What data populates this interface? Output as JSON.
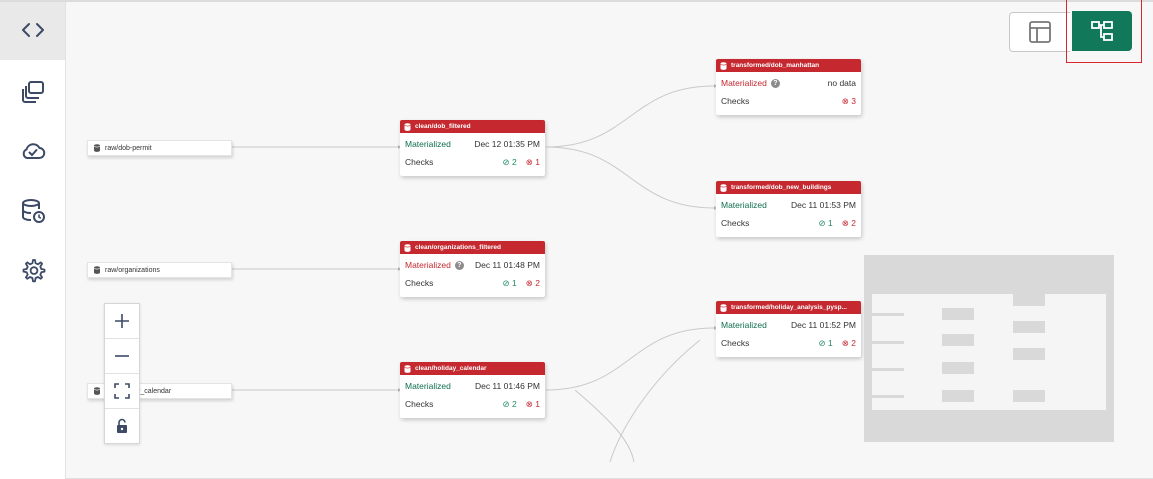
{
  "sidebar": {
    "items": [
      {
        "icon": "code-icon",
        "active": true
      },
      {
        "icon": "layers-icon"
      },
      {
        "icon": "cloud-check-icon"
      },
      {
        "icon": "database-clock-icon"
      },
      {
        "icon": "gear-icon"
      }
    ]
  },
  "view_toggle": {
    "table_icon": "table-view-icon",
    "lineage_icon": "lineage-view-icon",
    "active": "lineage",
    "active_color": "#12785a"
  },
  "sources": [
    {
      "label": "raw/dob-permit"
    },
    {
      "label": "raw/organizations"
    },
    {
      "label": "raw/holiday_calendar"
    }
  ],
  "nodes": [
    {
      "title": "clean/dob_filtered",
      "status": "Materialized",
      "status_ok": true,
      "date": "Dec 12 01:35 PM",
      "checks_label": "Checks",
      "pass": "2",
      "fail": "1"
    },
    {
      "title": "clean/organizations_filtered",
      "status": "Materialized",
      "status_ok": false,
      "help": "?",
      "date": "Dec 11 01:48 PM",
      "checks_label": "Checks",
      "pass": "1",
      "fail": "2"
    },
    {
      "title": "clean/holiday_calendar",
      "status": "Materialized",
      "status_ok": true,
      "date": "Dec 11 01:46 PM",
      "checks_label": "Checks",
      "pass": "2",
      "fail": "1"
    },
    {
      "title": "transformed/dob_manhattan",
      "status": "Materialized",
      "status_ok": false,
      "help": "?",
      "date": "no data",
      "checks_label": "Checks",
      "pass": "",
      "fail": "3"
    },
    {
      "title": "transformed/dob_new_buildings",
      "status": "Materialized",
      "status_ok": true,
      "date": "Dec 11 01:53 PM",
      "checks_label": "Checks",
      "pass": "1",
      "fail": "2"
    },
    {
      "title": "transformed/holiday_analysis_pysp...",
      "status": "Materialized",
      "status_ok": true,
      "date": "Dec 11 01:52 PM",
      "checks_label": "Checks",
      "pass": "1",
      "fail": "2"
    }
  ],
  "symbols": {
    "pass": "⊘",
    "fail": "⊗"
  },
  "controls": [
    {
      "icon": "zoom-in-icon",
      "glyph": "+"
    },
    {
      "icon": "zoom-out-icon",
      "glyph": "−"
    },
    {
      "icon": "fit-view-icon"
    },
    {
      "icon": "lock-icon"
    }
  ],
  "colors": {
    "header_red": "#c5282f",
    "ok_green": "#0f6e4f"
  }
}
